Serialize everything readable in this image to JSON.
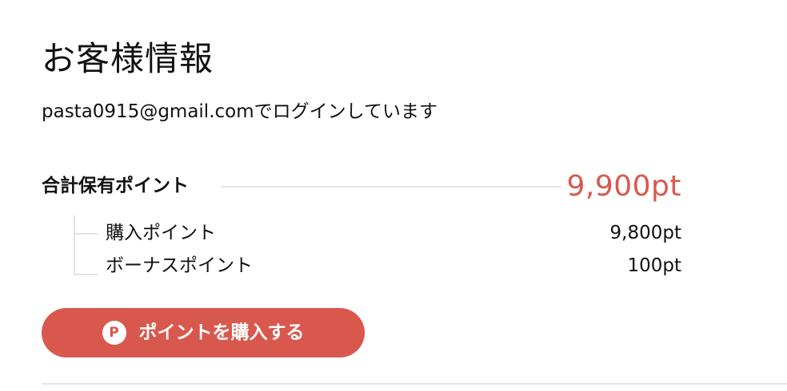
{
  "page": {
    "title": "お客様情報",
    "login_status": "pasta0915@gmail.comでログインしています"
  },
  "points": {
    "total_label": "合計保有ポイント",
    "total_value": "9,900pt",
    "breakdown": [
      {
        "label": "購入ポイント",
        "value": "9,800pt"
      },
      {
        "label": "ボーナスポイント",
        "value": "100pt"
      }
    ]
  },
  "buy_button": {
    "icon_letter": "P",
    "label": "ポイントを購入する"
  },
  "icons": {
    "buy_button_icon": "point-p-icon"
  },
  "colors": {
    "accent": "#d9584e",
    "divider": "#e6e6e6",
    "text": "#111111"
  }
}
